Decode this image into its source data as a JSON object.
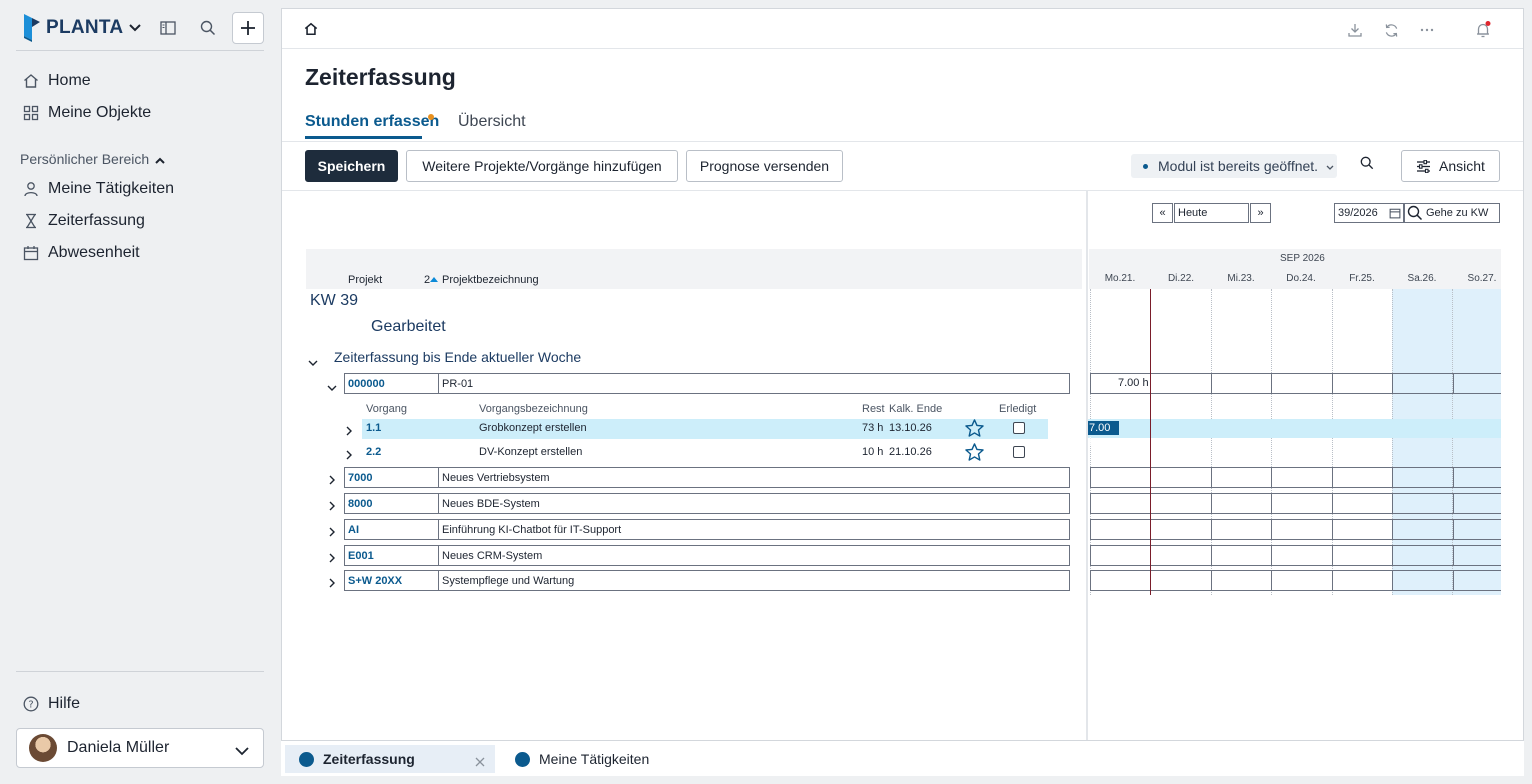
{
  "brand": {
    "name": "PLANTA"
  },
  "sidebar": {
    "nav": [
      {
        "label": "Home",
        "icon": "home-icon"
      },
      {
        "label": "Meine Objekte",
        "icon": "grid-icon"
      }
    ],
    "section_label": "Persönlicher Bereich",
    "personal": [
      {
        "label": "Meine Tätigkeiten",
        "icon": "person-icon"
      },
      {
        "label": "Zeiterfassung",
        "icon": "hourglass-icon"
      },
      {
        "label": "Abwesenheit",
        "icon": "calendar-icon"
      }
    ],
    "help_label": "Hilfe",
    "user_name": "Daniela Müller"
  },
  "page": {
    "title": "Zeiterfassung",
    "tabs": [
      {
        "label": "Stunden erfassen",
        "active": true
      },
      {
        "label": "Übersicht",
        "active": false
      }
    ]
  },
  "toolbar": {
    "save_label": "Speichern",
    "add_label": "Weitere Projekte/Vorgänge hinzufügen",
    "forecast_label": "Prognose versenden",
    "modul_status": "Modul ist bereits geöffnet.",
    "view_label": "Ansicht"
  },
  "calendar": {
    "prev": "«",
    "next": "»",
    "today_value": "Heute",
    "week_value": "39/2026",
    "goto_placeholder": "Gehe zu KW",
    "month": "SEP 2026",
    "days": [
      "Mo.21.",
      "Di.22.",
      "Mi.23.",
      "Do.24.",
      "Fr.25.",
      "Sa.26.",
      "So.27."
    ]
  },
  "grid": {
    "col_projekt": "Projekt",
    "col_sort": "2",
    "col_bezeichnung": "Projektbezeichnung",
    "week_label": "KW 39",
    "section_label": "Gearbeitet",
    "group_label": "Zeiterfassung bis Ende aktueller Woche",
    "task_headers": {
      "vorgang": "Vorgang",
      "bezeichnung": "Vorgangsbezeichnung",
      "rest": "Rest",
      "end": "Kalk. Ende",
      "done": "Erledigt"
    },
    "projects": [
      {
        "id": "000000",
        "name": "PR-01",
        "mon": "7.00 h"
      },
      {
        "id": "7000",
        "name": "Neues Vertriebsystem",
        "mon": ""
      },
      {
        "id": "8000",
        "name": "Neues BDE-System",
        "mon": ""
      },
      {
        "id": "AI",
        "name": "Einführung KI-Chatbot für IT-Support",
        "mon": ""
      },
      {
        "id": "E001",
        "name": "Neues CRM-System",
        "mon": ""
      },
      {
        "id": "S+W 20XX",
        "name": "Systempflege und Wartung",
        "mon": ""
      }
    ],
    "tasks": [
      {
        "id": "1.1",
        "name": "Grobkonzept erstellen",
        "rest": "73 h",
        "end": "13.10.26",
        "mon": "7.00 h"
      },
      {
        "id": "2.2",
        "name": "DV-Konzept erstellen",
        "rest": "10 h",
        "end": "21.10.26",
        "mon": ""
      }
    ]
  },
  "bottom_tabs": [
    {
      "label": "Zeiterfassung"
    },
    {
      "label": "Meine Tätigkeiten"
    }
  ],
  "colors": {
    "accent": "#0b5a8e",
    "primary_button": "#1e2c3c",
    "selection": "#cdeefa",
    "weekend": "#dff0fb"
  }
}
